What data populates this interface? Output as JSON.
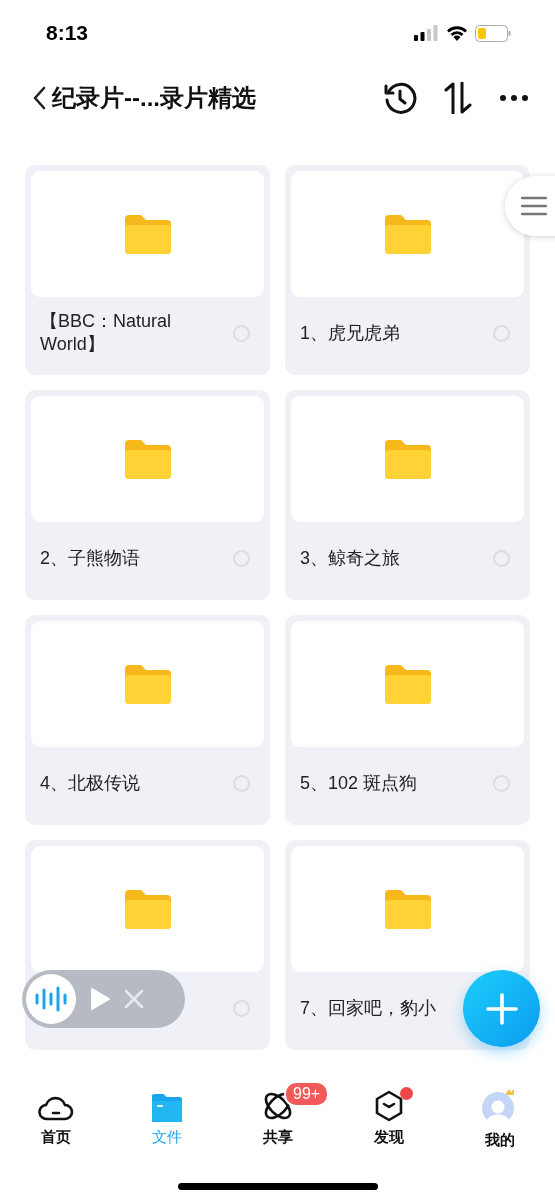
{
  "status_bar": {
    "time": "8:13"
  },
  "header": {
    "title": "纪录片--...录片精选"
  },
  "folders": [
    {
      "name": "【BBC：Natural World】",
      "selected": false
    },
    {
      "name": "1、虎兄虎弟",
      "selected": false
    },
    {
      "name": "2、子熊物语",
      "selected": false
    },
    {
      "name": "3、鲸奇之旅",
      "selected": false
    },
    {
      "name": "4、北极传说",
      "selected": false
    },
    {
      "name": "5、102 斑点狗",
      "selected": false
    },
    {
      "selected": false
    },
    {
      "name": "7、回家吧，豹小"
    }
  ],
  "tabs": [
    {
      "kind": "home",
      "label": "首页",
      "selected": false
    },
    {
      "kind": "files",
      "label": "文件",
      "selected": true
    },
    {
      "kind": "share",
      "label": "共享",
      "selected": false,
      "badge": "99+"
    },
    {
      "kind": "discover",
      "label": "发现",
      "selected": false,
      "dot": true
    },
    {
      "kind": "profile",
      "label": "我的",
      "selected": false
    }
  ]
}
